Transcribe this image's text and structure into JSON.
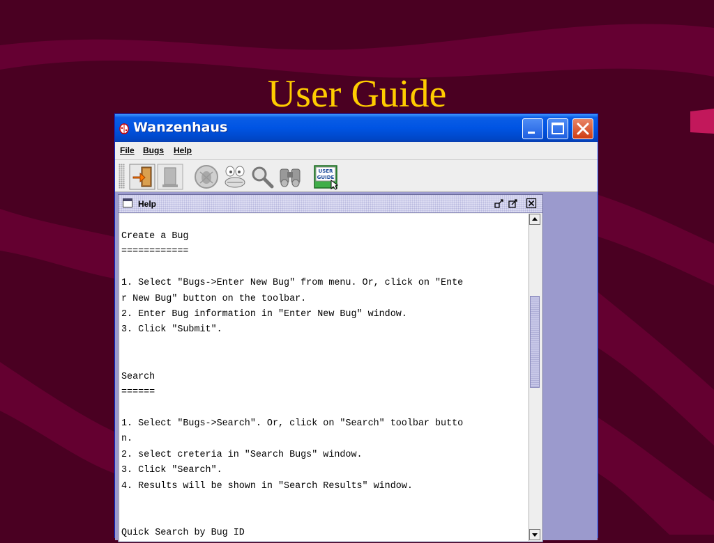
{
  "slide": {
    "title": "User Guide"
  },
  "window": {
    "title": "Wanzenhaus"
  },
  "menu": {
    "items": [
      "File",
      "Bugs",
      "Help"
    ]
  },
  "toolbar": {
    "buttons": [
      "exit-icon",
      "bin-icon",
      "bug-icon",
      "bug-face-icon",
      "search-icon",
      "binoculars-icon",
      "user-guide-icon"
    ],
    "user_guide_label_line1": "USER",
    "user_guide_label_line2": "GUIDE"
  },
  "help": {
    "title": "Help",
    "lines": [
      "Create a Bug",
      "============",
      "",
      "1. Select \"Bugs->Enter New Bug\" from menu. Or, click on \"Ente",
      "r New Bug\" button on the toolbar.",
      "2. Enter Bug information in \"Enter New Bug\" window.",
      "3. Click \"Submit\".",
      "",
      "",
      "Search",
      "======",
      "",
      "1. Select \"Bugs->Search\". Or, click on \"Search\" toolbar butto",
      "n.",
      "2. select creteria in \"Search Bugs\" window.",
      "3. Click \"Search\".",
      "4. Results will be shown in \"Search Results\" window.",
      "",
      "",
      "Quick Search by Bug ID"
    ]
  },
  "colors": {
    "slide_background": "#4a0022",
    "slide_title": "#ffcc00",
    "desktop": "#9b9acd",
    "titlebar": "#0054e3"
  }
}
